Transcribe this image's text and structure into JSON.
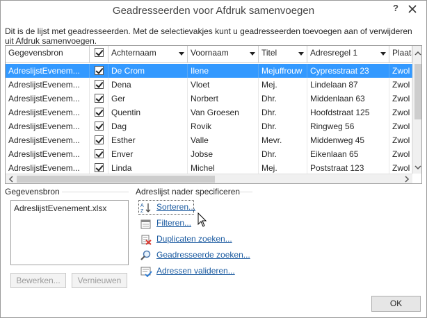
{
  "window": {
    "title": "Geadresseerden voor Afdruk samenvoegen",
    "help_label": "?"
  },
  "description": "Dit is de lijst met geadresseerden. Met de selectievakjes kunt u geadresseerden toevoegen aan of verwijderen uit Afdruk samenvoegen.",
  "grid": {
    "headers": [
      "Gegevensbron",
      "",
      "Achternaam",
      "Voornaam",
      "Titel",
      "Adresregel 1",
      "Plaats"
    ],
    "rows": [
      {
        "source": "AdreslijstEvenem...",
        "checked": true,
        "achternaam": "De Crom",
        "voornaam": "Ilene",
        "titel": "Mejuffrouw",
        "adres": "Cypresstraat 23",
        "plaats": "Zwol"
      },
      {
        "source": "AdreslijstEvenem...",
        "checked": true,
        "achternaam": "Dena",
        "voornaam": "Vloet",
        "titel": "Mej.",
        "adres": "Lindelaan 87",
        "plaats": "Zwol"
      },
      {
        "source": "AdreslijstEvenem...",
        "checked": true,
        "achternaam": "Ger",
        "voornaam": "Norbert",
        "titel": "Dhr.",
        "adres": "Middenlaan 63",
        "plaats": "Zwol"
      },
      {
        "source": "AdreslijstEvenem...",
        "checked": true,
        "achternaam": "Quentin",
        "voornaam": "Van Groesen",
        "titel": "Dhr.",
        "adres": "Hoofdstraat 125",
        "plaats": "Zwol"
      },
      {
        "source": "AdreslijstEvenem...",
        "checked": true,
        "achternaam": "Dag",
        "voornaam": "Rovik",
        "titel": "Dhr.",
        "adres": "Ringweg 56",
        "plaats": "Zwol"
      },
      {
        "source": "AdreslijstEvenem...",
        "checked": true,
        "achternaam": "Esther",
        "voornaam": "Valle",
        "titel": "Mevr.",
        "adres": "Middenweg 45",
        "plaats": "Zwol"
      },
      {
        "source": "AdreslijstEvenem...",
        "checked": true,
        "achternaam": "Enver",
        "voornaam": "Jobse",
        "titel": "Dhr.",
        "adres": "Eikenlaan 65",
        "plaats": "Zwol"
      },
      {
        "source": "AdreslijstEvenem...",
        "checked": true,
        "achternaam": "Linda",
        "voornaam": "Michel",
        "titel": "Mej.",
        "adres": "Poststraat 123",
        "plaats": "Zwol"
      }
    ],
    "selected_row": 0
  },
  "datasource": {
    "label": "Gegevensbron",
    "items": [
      "AdreslijstEvenement.xlsx"
    ],
    "edit_button": "Bewerken...",
    "refresh_button": "Vernieuwen"
  },
  "refine": {
    "label": "Adreslijst nader specificeren",
    "links": [
      {
        "label": "Sorteren...",
        "icon": "sort-az-icon"
      },
      {
        "label": "Filteren...",
        "icon": "filter-icon"
      },
      {
        "label": "Duplicaten zoeken...",
        "icon": "duplicates-icon"
      },
      {
        "label": "Geadresseerde zoeken...",
        "icon": "find-recipient-icon"
      },
      {
        "label": "Adressen valideren...",
        "icon": "validate-addresses-icon"
      }
    ]
  },
  "ok_button": "OK",
  "colors": {
    "selection": "#3399ff",
    "link": "#1a5aa0"
  }
}
